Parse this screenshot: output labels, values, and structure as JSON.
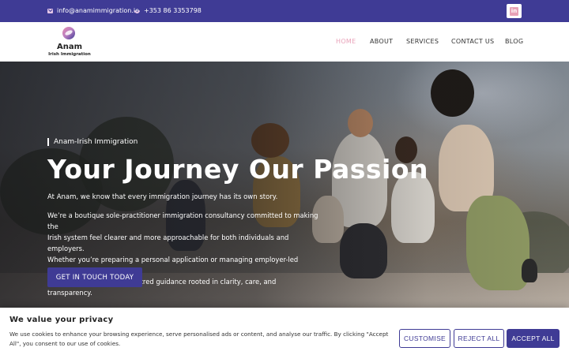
{
  "topbar": {
    "email": "info@anamimmigration.ie",
    "phone": "+353 86 3353798",
    "linkedin_icon": "linkedin-icon"
  },
  "header": {
    "logo_name": "Anam",
    "logo_subtitle": "Irish Immigration",
    "nav": [
      "HOME",
      "ABOUT",
      "SERVICES",
      "CONTACT US",
      "BLOG"
    ],
    "active_nav": "HOME"
  },
  "hero": {
    "tag": "Anam-Irish Immigration",
    "title": "Your Journey Our Passion",
    "intro": "At Anam, we know that every immigration journey has its own story.",
    "body_lines": [
      "We’re a boutique sole-practitioner immigration consultancy committed to making the",
      "Irish system feel clearer and more approachable for both individuals and employers.",
      "Whether you’re preparing a personal application or managing employer-led permissions,",
      "we offer steady, human-centred guidance rooted in clarity, care, and transparency."
    ],
    "cta": "GET IN TOUCH TODAY"
  },
  "cookie": {
    "title": "We value your privacy",
    "text": "We use cookies to enhance your browsing experience, serve personalised ads or content, and analyse our traffic. By clicking \"Accept All\", you consent to our use of cookies.",
    "customise": "CUSTOMISE",
    "reject": "REJECT ALL",
    "accept": "ACCEPT ALL"
  },
  "colors": {
    "brand": "#3f3b95",
    "accent_pink": "#e9a2b9"
  }
}
